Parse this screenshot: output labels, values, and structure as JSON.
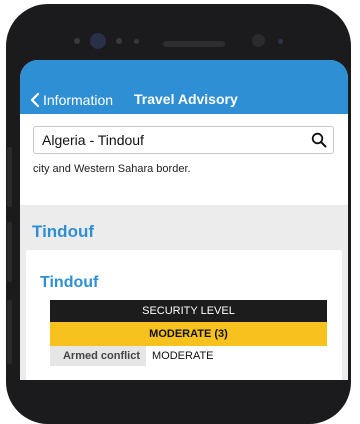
{
  "header": {
    "back_label": "Information",
    "title": "Travel Advisory",
    "color": "#2f8fd4"
  },
  "search": {
    "value": "Algeria - Tindouf",
    "icon": "search-icon"
  },
  "snippet_text": "city and Western Sahara border.",
  "section": {
    "title": "Tindouf"
  },
  "card": {
    "title": "Tindouf",
    "security_header": "SECURITY LEVEL",
    "security_level": "MODERATE (3)",
    "level_color": "#f7c21e",
    "rows": [
      {
        "label": "Armed conflict",
        "value": "MODERATE"
      }
    ]
  }
}
